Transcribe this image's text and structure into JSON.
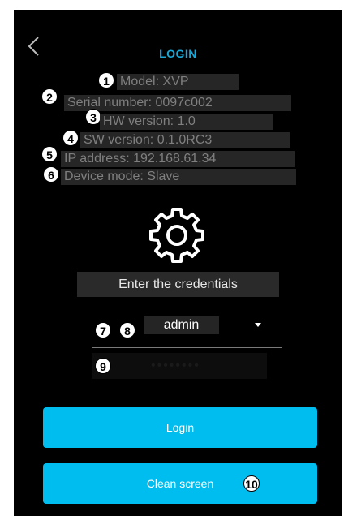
{
  "header": {
    "title": "LOGIN"
  },
  "info": {
    "model": "Model: XVP",
    "serial": "Serial number: 0097c002",
    "hw": "HW version: 1.0",
    "sw": "SW version: 0.1.0RC3",
    "ip": "IP address: 192.168.61.34",
    "mode": "Device mode: Slave"
  },
  "badges": [
    "1",
    "2",
    "3",
    "4",
    "5",
    "6",
    "7",
    "8",
    "9",
    "10"
  ],
  "login": {
    "prompt": "Enter the credentials",
    "user_value": "admin",
    "password_value": "••••••••"
  },
  "buttons": {
    "login_label": "Login",
    "clean_label": "Clean screen"
  },
  "icons": {
    "back": "chevron-left-icon",
    "settings": "gear-icon",
    "dropdown": "caret-down-icon"
  },
  "colors": {
    "background": "#000000",
    "accent": "#00bdf0",
    "title": "#18a7d6",
    "info_text": "#7f7f7f"
  }
}
